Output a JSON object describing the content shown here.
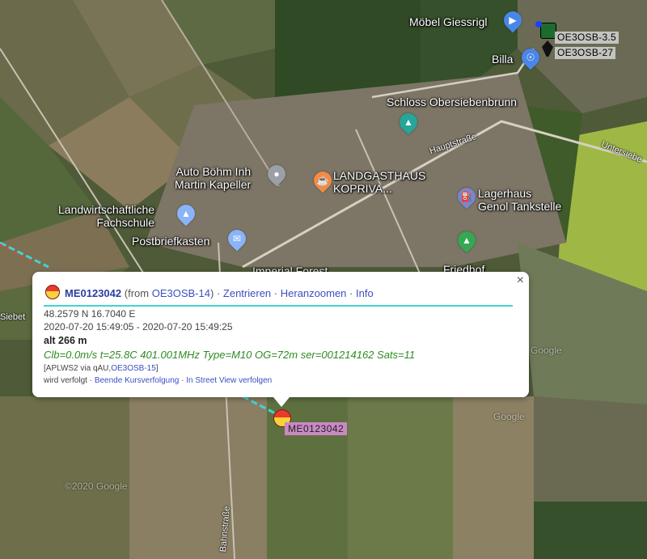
{
  "map": {
    "pois": [
      {
        "id": "moebel",
        "label": "Möbel Giessrigl",
        "icon": "shopping-bag-icon",
        "color": "#4a86e8"
      },
      {
        "id": "billa",
        "label": "Billa",
        "icon": "shopping-cart-icon",
        "color": "#4a86e8"
      },
      {
        "id": "schloss",
        "label": "Schloss Obersiebenbrunn",
        "icon": "landmark-icon",
        "color": "#26a69a"
      },
      {
        "id": "autoboehm",
        "label": "Auto Böhm Inh\nMartin Kapeller",
        "icon": "place-icon",
        "color": "#9aa0a6"
      },
      {
        "id": "landgasthaus",
        "label": "LANDGASTHAUS\nKOPRIVA...",
        "icon": "restaurant-icon",
        "color": "#f28b46"
      },
      {
        "id": "lagerhaus",
        "label": "Lagerhaus\nGenol Tankstelle",
        "icon": "fuel-icon",
        "color": "#7986cb"
      },
      {
        "id": "fachschule",
        "label": "Landwirtschaftliche\nFachschule",
        "icon": "school-icon",
        "color": "#8ab4f8"
      },
      {
        "id": "postbrief",
        "label": "Postbriefkasten",
        "icon": "mail-icon",
        "color": "#8ab4f8"
      },
      {
        "id": "friedhof",
        "label": "Friedhof",
        "icon": "tree-icon",
        "color": "#34a853"
      }
    ],
    "streets": [
      "Hauptstraße",
      "Untersiebe",
      "Bahnstraße",
      "Siebet"
    ],
    "watermarks": [
      "Google",
      "©2020 Google",
      "Google"
    ],
    "partial_label": "Imperial Forest",
    "stations": [
      "OE3OSB-3.5",
      "OE3OSB-27"
    ],
    "track_callsign": "ME0123042"
  },
  "popup": {
    "callsign": "ME0123042",
    "from_prefix": "(from ",
    "from_station": "OE3OSB-14",
    "from_suffix": ")",
    "sep": "·",
    "link_center": "Zentrieren",
    "link_zoom": "Heranzoomen",
    "link_info": "Info",
    "coords": "48.2579 N 16.7040 E",
    "time_range": "2020-07-20 15:49:05 - 2020-07-20 15:49:25",
    "altitude": "alt 266 m",
    "comment": "Clb=0.0m/s t=25.8C 401.001MHz Type=M10 OG=72m ser=001214162 Sats=11",
    "path_prefix": "[APLWS2 via qAU,",
    "path_station": "OE3OSB-15",
    "path_suffix": "]",
    "tracked_label": "wird verfolgt",
    "link_stop_tracking": "Beende Kursverfolgung",
    "link_streetview": "In Street View verfolgen",
    "close_symbol": "×"
  }
}
